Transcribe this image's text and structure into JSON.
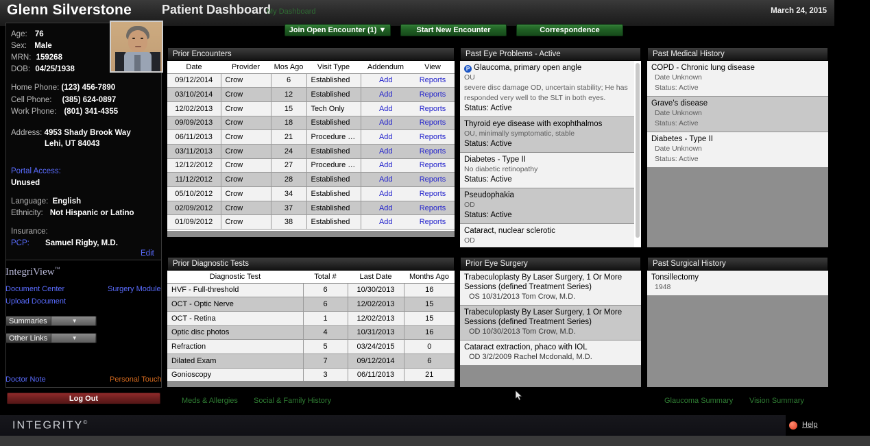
{
  "header": {
    "patient_name": "Glenn Silverstone",
    "page_title": "Patient Dashboard",
    "my_dashboard": "My Dashboard",
    "date": "March 24, 2015",
    "buttons": {
      "join": "Join Open Encounter (1) ▼",
      "new": "Start New Encounter",
      "correspondence": "Correspondence"
    }
  },
  "demographics": {
    "age_label": "Age:",
    "age_value": "76",
    "sex_label": "Sex:",
    "sex_value": "Male",
    "mrn_label": "MRN:",
    "mrn_value": "159268",
    "dob_label": "DOB:",
    "dob_value": "04/25/1938",
    "home_phone_label": "Home Phone:",
    "home_phone_value": "(123) 456-7890",
    "cell_phone_label": "Cell Phone:",
    "cell_phone_value": "(385) 624-0897",
    "work_phone_label": "Work Phone:",
    "work_phone_value": "(801) 341-4355",
    "address_label": "Address:",
    "address_line1": "4953 Shady Brook Way",
    "address_line2": "Lehi, UT 84043",
    "portal_access_label": "Portal Access:",
    "portal_access_value": "Unused",
    "language_label": "Language:",
    "language_value": "English",
    "ethnicity_label": "Ethnicity:",
    "ethnicity_value": "Not Hispanic or Latino",
    "insurance_label": "Insurance:",
    "pcp_label": "PCP:",
    "pcp_value": "Samuel Rigby, M.D.",
    "edit_link": "Edit"
  },
  "integriview": {
    "title": "IntegriView",
    "tm": "™",
    "document_center": "Document Center",
    "surgery_module": "Surgery Module",
    "upload_document": "Upload Document",
    "summaries_select": "Summaries",
    "other_links_select": "Other Links",
    "doctor_note": "Doctor Note",
    "personal_touch": "Personal Touch",
    "log_out": "Log Out"
  },
  "prior_encounters": {
    "title": "Prior Encounters",
    "columns": [
      "Date",
      "Provider",
      "Mos Ago",
      "Visit Type",
      "Addendum",
      "View"
    ],
    "rows": [
      [
        "09/12/2014",
        "Crow",
        "6",
        "Established",
        "Add",
        "Reports"
      ],
      [
        "03/10/2014",
        "Crow",
        "12",
        "Established",
        "Add",
        "Reports"
      ],
      [
        "12/02/2013",
        "Crow",
        "15",
        "Tech Only",
        "Add",
        "Reports"
      ],
      [
        "09/09/2013",
        "Crow",
        "18",
        "Established",
        "Add",
        "Reports"
      ],
      [
        "06/11/2013",
        "Crow",
        "21",
        "Procedure …",
        "Add",
        "Reports"
      ],
      [
        "03/11/2013",
        "Crow",
        "24",
        "Established",
        "Add",
        "Reports"
      ],
      [
        "12/12/2012",
        "Crow",
        "27",
        "Procedure …",
        "Add",
        "Reports"
      ],
      [
        "11/12/2012",
        "Crow",
        "28",
        "Established",
        "Add",
        "Reports"
      ],
      [
        "05/10/2012",
        "Crow",
        "34",
        "Established",
        "Add",
        "Reports"
      ],
      [
        "02/09/2012",
        "Crow",
        "37",
        "Established",
        "Add",
        "Reports"
      ],
      [
        "01/09/2012",
        "Crow",
        "38",
        "Established",
        "Add",
        "Reports"
      ]
    ]
  },
  "prior_diagnostic_tests": {
    "title": "Prior Diagnostic Tests",
    "columns": [
      "Diagnostic Test",
      "Total #",
      "Last Date",
      "Months Ago"
    ],
    "rows": [
      [
        "HVF - Full-threshold",
        "6",
        "10/30/2013",
        "16"
      ],
      [
        "OCT - Optic Nerve",
        "6",
        "12/02/2013",
        "15"
      ],
      [
        "OCT - Retina",
        "1",
        "12/02/2013",
        "15"
      ],
      [
        "Optic disc photos",
        "4",
        "10/31/2013",
        "16"
      ],
      [
        "Refraction",
        "5",
        "03/24/2015",
        "0"
      ],
      [
        "Dilated Exam",
        "7",
        "09/12/2014",
        "6"
      ],
      [
        "Gonioscopy",
        "3",
        "06/11/2013",
        "21"
      ]
    ]
  },
  "past_eye_problems": {
    "title": "Past Eye Problems - Active",
    "items": [
      {
        "badge": "P",
        "name": "Glaucoma, primary open angle",
        "eye": "OU",
        "note1": "severe disc damage OD, uncertain stability; He has",
        "note2": "responded very well to the SLT in both eyes.",
        "status": "Status: Active"
      },
      {
        "badge": "",
        "name": "Thyroid eye disease with exophthalmos",
        "eye": "OU, minimally symptomatic, stable",
        "note1": "",
        "note2": "",
        "status": "Status: Active"
      },
      {
        "badge": "",
        "name": "Diabetes - Type II",
        "eye": "No diabetic retinopathy",
        "note1": "",
        "note2": "",
        "status": "Status: Active"
      },
      {
        "badge": "",
        "name": "Pseudophakia",
        "eye": "OD",
        "note1": "",
        "note2": "",
        "status": "Status: Active"
      },
      {
        "badge": "",
        "name": "Cataract, nuclear sclerotic",
        "eye": "OD",
        "note1": "",
        "note2": "",
        "status": ""
      }
    ]
  },
  "past_medical_history": {
    "title": "Past Medical History",
    "items": [
      {
        "name": "COPD - Chronic lung disease",
        "date": "Date Unknown",
        "status": "Status: Active"
      },
      {
        "name": "Grave's disease",
        "date": "Date Unknown",
        "status": "Status: Active"
      },
      {
        "name": "Diabetes - Type II",
        "date": "Date Unknown",
        "status": "Status: Active"
      }
    ]
  },
  "prior_eye_surgery": {
    "title": "Prior Eye Surgery",
    "items": [
      {
        "line1": "Trabeculoplasty By Laser Surgery, 1 Or More",
        "line2": "Sessions (defined Treatment Series)",
        "meta": "OS  10/31/2013  Tom Crow, M.D."
      },
      {
        "line1": "Trabeculoplasty By Laser Surgery, 1 Or More",
        "line2": "Sessions (defined Treatment Series)",
        "meta": "OD  10/30/2013  Tom Crow, M.D."
      },
      {
        "line1": "Cataract extraction, phaco with IOL",
        "line2": "",
        "meta": "OD  3/2/2009  Rachel Mcdonald, M.D."
      }
    ]
  },
  "past_surgical_history": {
    "title": "Past Surgical History",
    "items": [
      {
        "name": "Tonsillectomy",
        "date": "1948"
      }
    ]
  },
  "bottom_links": {
    "meds_allergies": "Meds & Allergies",
    "social_family": "Social & Family History",
    "glaucoma_summary": "Glaucoma Summary",
    "vision_summary": "Vision Summary"
  },
  "footer": {
    "logo": "INTEGRITY",
    "copyright": "©",
    "help": "Help"
  }
}
